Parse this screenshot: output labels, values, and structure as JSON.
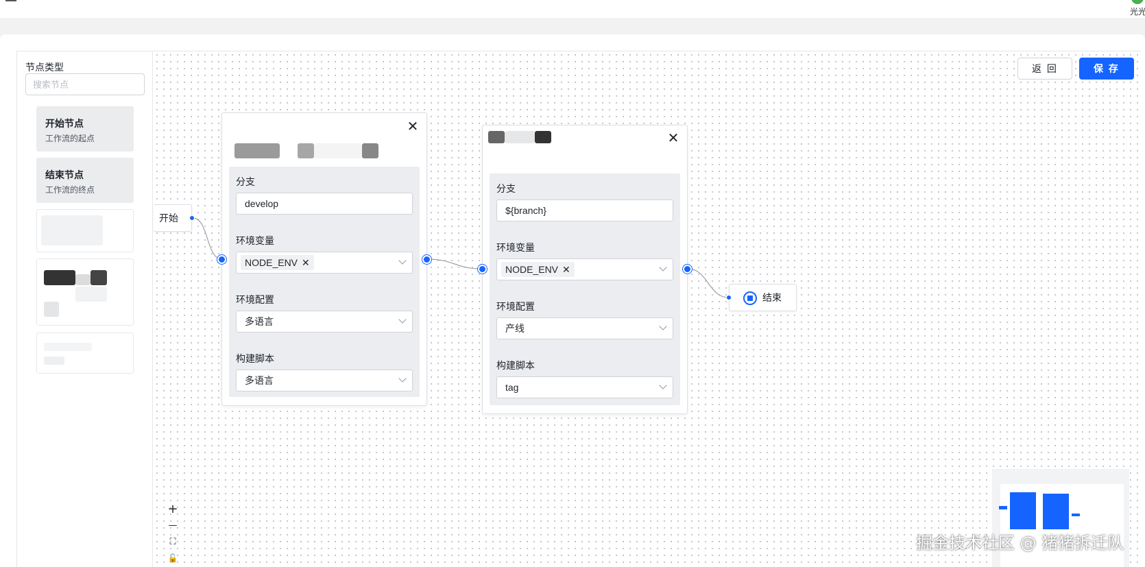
{
  "header": {
    "user_name": "光光"
  },
  "sidebar": {
    "title": "节点类型",
    "search_placeholder": "搜索节点",
    "node_types": [
      {
        "title": "开始节点",
        "description": "工作流的起点"
      },
      {
        "title": "结束节点",
        "description": "工作流的终点"
      }
    ]
  },
  "toolbar": {
    "back_label": "返 回",
    "save_label": "保 存"
  },
  "canvas": {
    "start_node_label": "开始",
    "end_node_label": "结束",
    "form_nodes": [
      {
        "branch_label": "分支",
        "branch_value": "develop",
        "env_var_label": "环境变量",
        "env_var_tag": "NODE_ENV",
        "env_config_label": "环境配置",
        "env_config_value": "多语言",
        "build_script_label": "构建脚本",
        "build_script_value": "多语言"
      },
      {
        "branch_label": "分支",
        "branch_value": "${branch}",
        "env_var_label": "环境变量",
        "env_var_tag": "NODE_ENV",
        "env_config_label": "环境配置",
        "env_config_value": "产线",
        "build_script_label": "构建脚本",
        "build_script_value": "tag"
      }
    ]
  },
  "zoom_controls": {
    "zoom_in": "+",
    "zoom_out": "—",
    "fit": "⛶",
    "lock": "🔓"
  },
  "watermark": "掘金技术社区 @ 猪猪拆迁队",
  "colors": {
    "primary": "#1664ff",
    "panel_bg": "#ebedf0",
    "canvas_dot": "#b8bcc4"
  },
  "icons": {
    "close": "close-icon",
    "end": "stop-circle-icon",
    "dropdown": "chevron-down-icon",
    "tag_remove": "tag-close-icon"
  }
}
